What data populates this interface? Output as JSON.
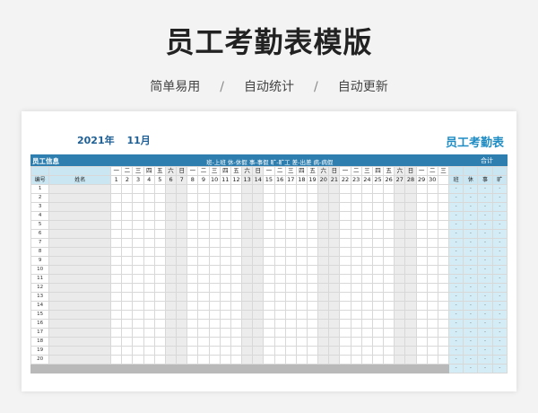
{
  "banner": {
    "title": "员工考勤表模版",
    "features": [
      "简单易用",
      "自动统计",
      "自动更新"
    ],
    "separator": "/"
  },
  "sheet": {
    "year_label": "2021年",
    "month_label": "11月",
    "title": "员工考勤表",
    "info_header": "员工信息",
    "legend": "班-上班  休-休假  事-事假  旷-旷工  差-出差  病-病假",
    "total_header": "合计",
    "col_no": "编号",
    "col_name": "姓名",
    "weekdays": [
      "一",
      "二",
      "三",
      "四",
      "五",
      "六",
      "日",
      "一",
      "二",
      "三",
      "四",
      "五",
      "六",
      "日",
      "一",
      "二",
      "三",
      "四",
      "五",
      "六",
      "日",
      "一",
      "二",
      "三",
      "四",
      "五",
      "六",
      "日",
      "一",
      "二"
    ],
    "weekday_extra": "三",
    "days": [
      "1",
      "2",
      "3",
      "4",
      "5",
      "6",
      "7",
      "8",
      "9",
      "10",
      "11",
      "12",
      "13",
      "14",
      "15",
      "16",
      "17",
      "18",
      "19",
      "20",
      "21",
      "22",
      "23",
      "24",
      "25",
      "26",
      "27",
      "28",
      "29",
      "30"
    ],
    "summary_headers": [
      "班",
      "休",
      "事",
      "旷"
    ],
    "row_numbers": [
      "1",
      "2",
      "3",
      "4",
      "5",
      "6",
      "7",
      "8",
      "9",
      "10",
      "11",
      "12",
      "13",
      "14",
      "15",
      "16",
      "17",
      "18",
      "19",
      "20"
    ],
    "placeholder": "-"
  }
}
